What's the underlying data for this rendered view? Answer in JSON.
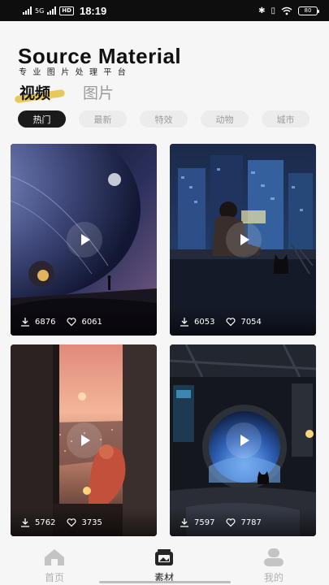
{
  "status_bar": {
    "network": "5G",
    "hd_badge": "HD",
    "time": "18:19",
    "battery": "80"
  },
  "header": {
    "title": "Source Material",
    "subtitle": "专业图片处理平台"
  },
  "main_tabs": [
    {
      "label": "视频",
      "active": true
    },
    {
      "label": "图片",
      "active": false
    }
  ],
  "filter_chips": [
    {
      "label": "热门",
      "active": true
    },
    {
      "label": "最新",
      "active": false
    },
    {
      "label": "特效",
      "active": false
    },
    {
      "label": "动物",
      "active": false
    },
    {
      "label": "城市",
      "active": false
    }
  ],
  "cards": [
    {
      "theme": "planet-horizon",
      "downloads": "6876",
      "likes": "6061"
    },
    {
      "theme": "city-rooftop-cat",
      "downloads": "6053",
      "likes": "7054"
    },
    {
      "theme": "sunset-window-girl",
      "downloads": "5762",
      "likes": "3735"
    },
    {
      "theme": "spaceship-porthole-cat",
      "downloads": "7597",
      "likes": "7787"
    }
  ],
  "bottom_nav": [
    {
      "label": "首页",
      "icon": "home-icon",
      "active": false
    },
    {
      "label": "素材",
      "icon": "gallery-icon",
      "active": true
    },
    {
      "label": "我的",
      "icon": "profile-icon",
      "active": false
    }
  ],
  "colors": {
    "accent": "#e5c44a",
    "chip_active": "#1b1b1b",
    "chip_inactive": "#ececec",
    "nav_inactive": "#b0b0b0"
  }
}
